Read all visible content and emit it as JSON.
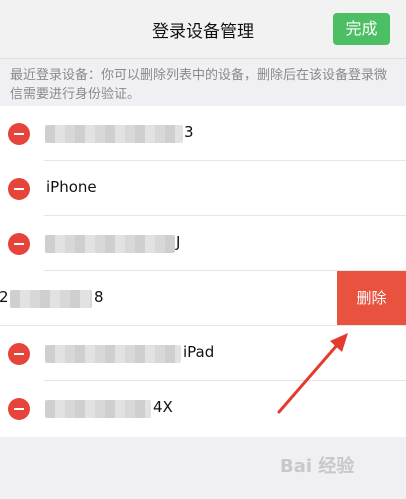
{
  "nav": {
    "title": "登录设备管理",
    "done_label": "完成"
  },
  "hint": "最近登录设备：你可以删除列表中的设备，删除后在该设备登录微信需要进行身份验证。",
  "devices": [
    {
      "name_suffix": "3"
    },
    {
      "name": "iPhone"
    },
    {
      "name_suffix": "J"
    },
    {
      "name_prefix": "2",
      "name_suffix": "8",
      "swiped": true,
      "delete_label": "删除"
    },
    {
      "name_suffix": "iPad"
    },
    {
      "name_suffix": "4X"
    }
  ],
  "watermark": "Bai 经验",
  "colors": {
    "accent_green": "#4cbe63",
    "delete_red": "#e9523f",
    "minus_red": "#e6433a",
    "arrow_red": "#e53a2e"
  }
}
